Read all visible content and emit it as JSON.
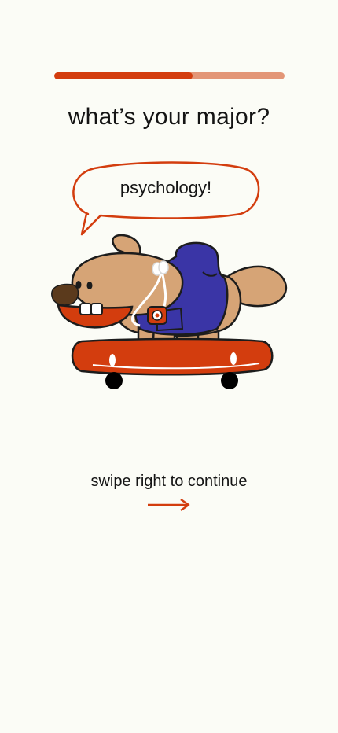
{
  "onboarding": {
    "progress": 0.6,
    "question": "what’s your major?",
    "answer": "psychology!",
    "swipe_hint": "swipe right to continue"
  },
  "colors": {
    "background": "#fbfcf6",
    "accent": "#d33d0e",
    "progress_track": "#e39677",
    "hoodie": "#3a35a6",
    "fur": "#d6a476"
  },
  "icons": {
    "arrow": "arrow-right-icon"
  }
}
